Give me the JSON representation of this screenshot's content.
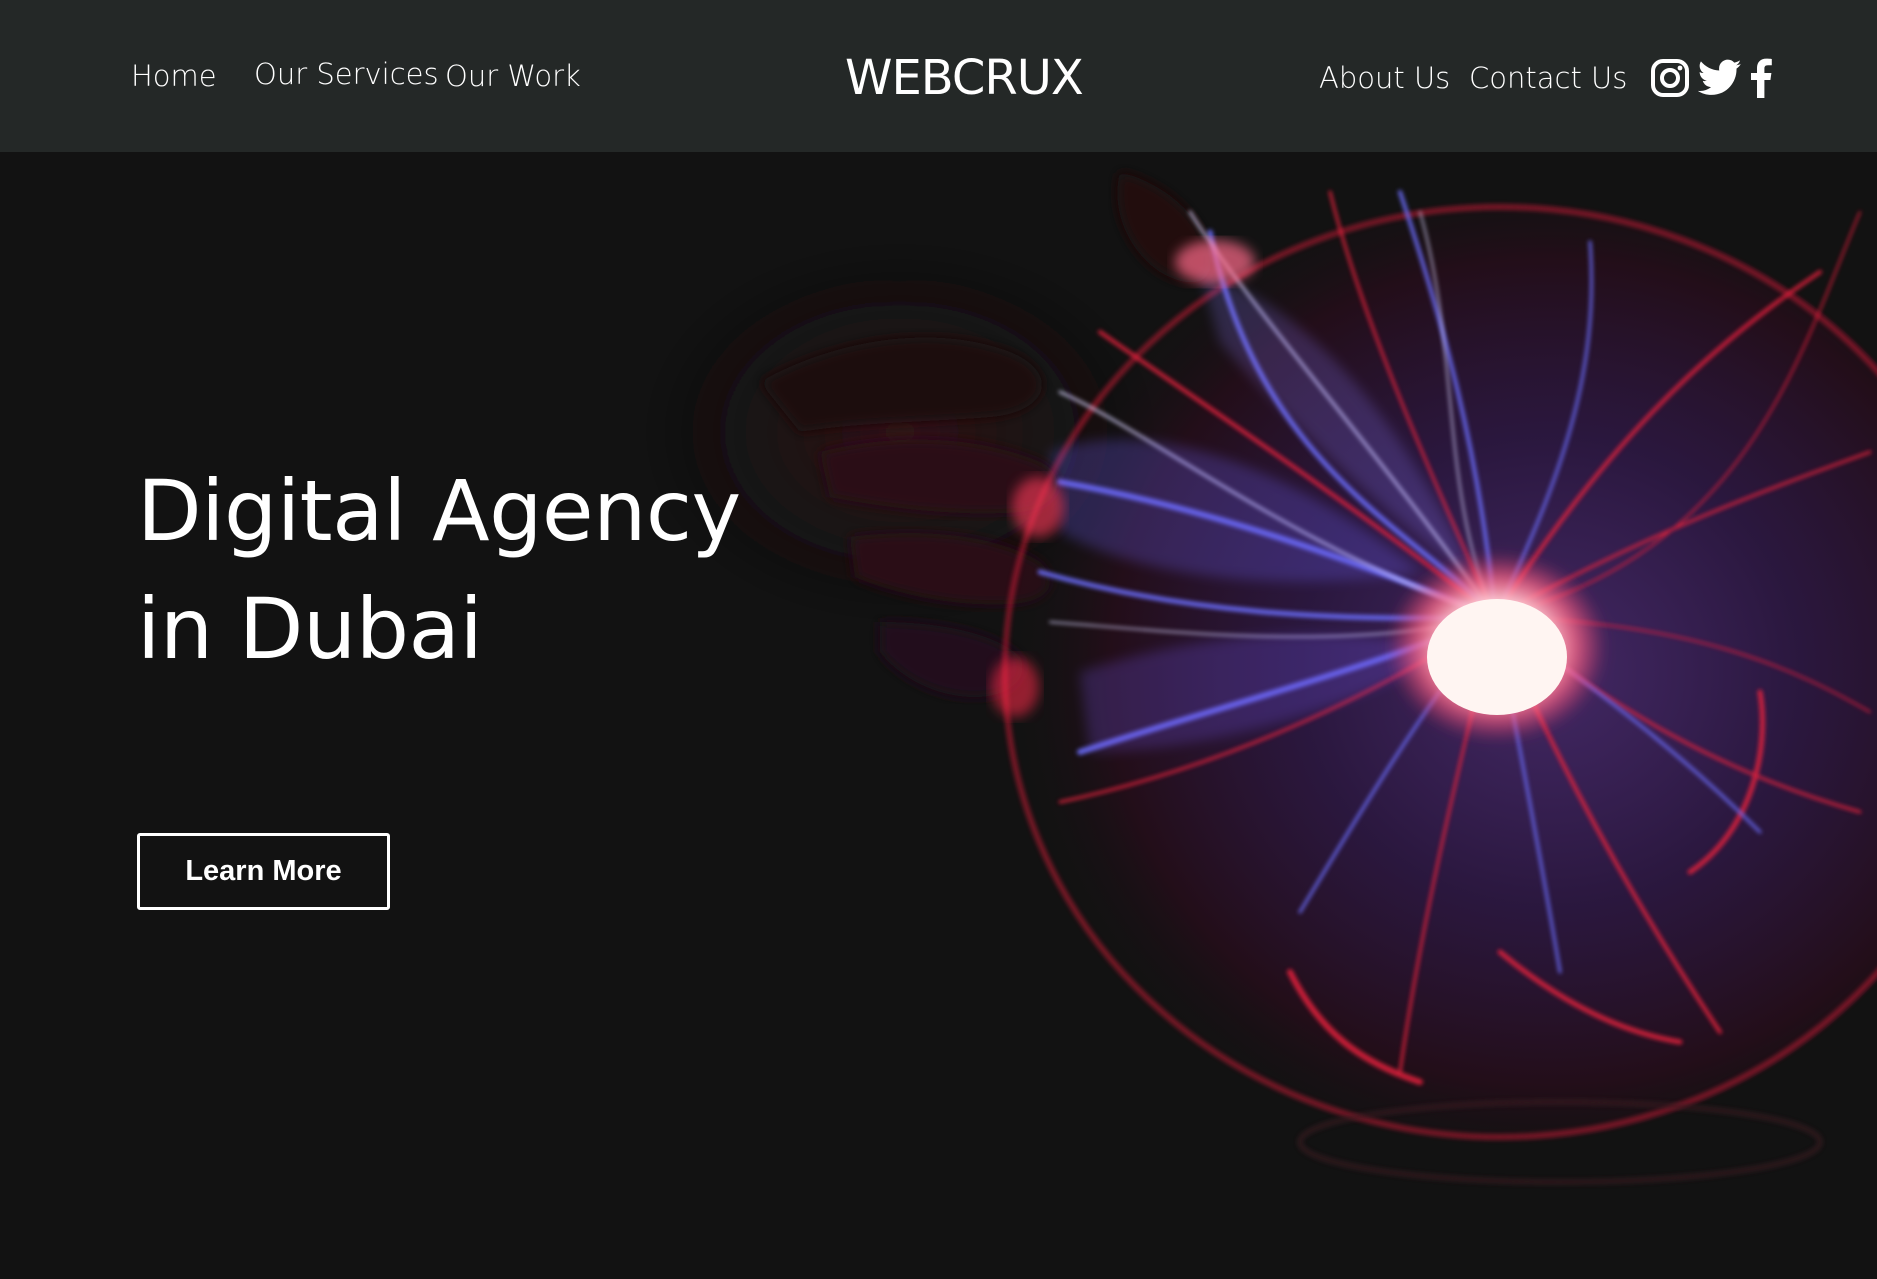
{
  "nav": {
    "home": "Home",
    "services": "Our Services",
    "work": "Our Work",
    "about": "About Us",
    "contact": "Contact Us",
    "logo": "WEBCRUX"
  },
  "social": {
    "icons": [
      "instagram-icon",
      "twitter-icon",
      "facebook-icon"
    ]
  },
  "hero": {
    "headline_line1": "Digital Agency",
    "headline_line2": "in Dubai",
    "cta_label": "Learn More",
    "image": "plasma-ball-image"
  },
  "colors": {
    "navbar_bg": "#242827",
    "page_bg": "#121212",
    "text": "#ffffff",
    "plasma_red": "#e8203c",
    "plasma_blue": "#5a5cf0"
  }
}
